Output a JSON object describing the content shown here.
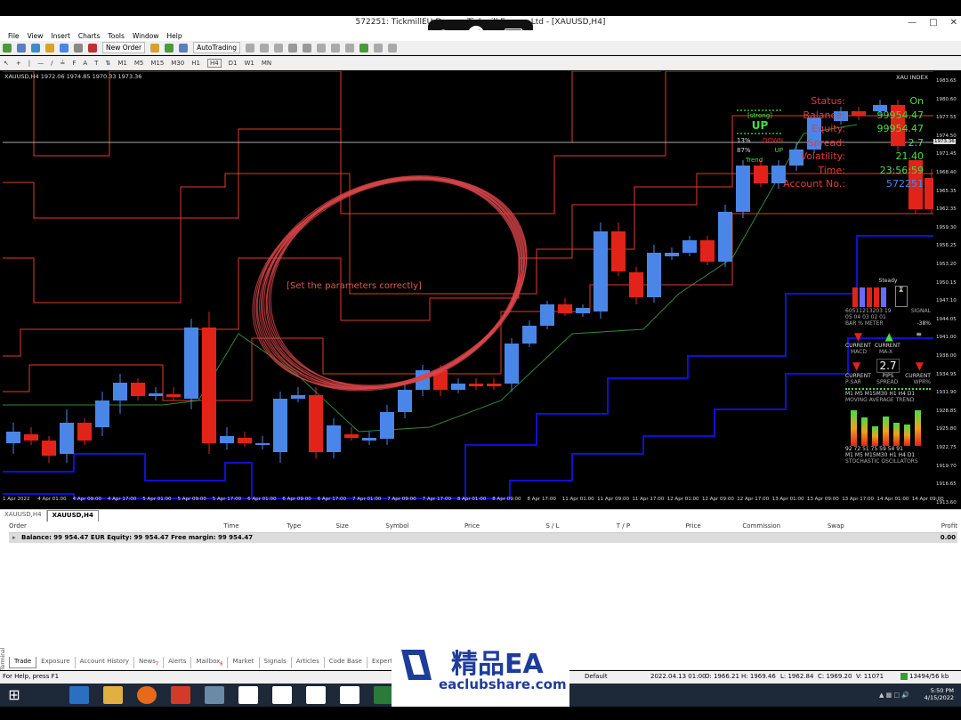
{
  "window": {
    "title": "572251: TickmillEU-Demo - Tickmill Europe Ltd - [XAUUSD,H4]",
    "controls": [
      "minimize-icon",
      "maximize-icon",
      "close-icon"
    ]
  },
  "remote_toolbar": {
    "icons": [
      "zoom-in-icon",
      "resize-icon",
      "keyboard-icon"
    ]
  },
  "menu": [
    "File",
    "View",
    "Insert",
    "Charts",
    "Tools",
    "Window",
    "Help"
  ],
  "toolbar": {
    "new_order": "New Order",
    "autotrading": "AutoTrading",
    "timeframes": [
      "M1",
      "M5",
      "M15",
      "M30",
      "H1",
      "H4",
      "D1",
      "W1",
      "MN"
    ],
    "active_timeframe": "H4"
  },
  "chart": {
    "info": "XAUUSD,H4  1972.06 1974.85 1970.33 1973.36",
    "index_label": "XAU INDEX",
    "center_text": "[Set the parameters correctly]",
    "current_price": "1973.36",
    "price_labels": [
      "1983.65",
      "1980.60",
      "1977.55",
      "1974.50",
      "1971.45",
      "1968.40",
      "1965.35",
      "1962.35",
      "1959.30",
      "1956.25",
      "1953.20",
      "1950.15",
      "1947.10",
      "1944.05",
      "1941.00",
      "1938.00",
      "1934.95",
      "1931.90",
      "1928.85",
      "1925.80",
      "1922.75",
      "1919.70",
      "1916.65",
      "1913.60"
    ],
    "time_labels": [
      "1 Apr 2022",
      "4 Apr 01:00",
      "4 Apr 09:00",
      "4 Apr 17:00",
      "5 Apr 01:00",
      "5 Apr 09:00",
      "5 Apr 17:00",
      "6 Apr 01:00",
      "6 Apr 09:00",
      "6 Apr 17:00",
      "7 Apr 01:00",
      "7 Apr 09:00",
      "7 Apr 17:00",
      "8 Apr 01:00",
      "8 Apr 09:00",
      "8 Apr 17:00",
      "11 Apr 01:00",
      "11 Apr 09:00",
      "11 Apr 17:00",
      "12 Apr 01:00",
      "12 Apr 09:00",
      "12 Apr 17:00",
      "13 Apr 01:00",
      "13 Apr 09:00",
      "13 Apr 17:00",
      "14 Apr 01:00",
      "14 Apr 09:00"
    ],
    "colors": {
      "bull": "#4a86e8",
      "bear": "#e2231a",
      "red_line": "#e53a2a",
      "green_line": "#2e8b3a",
      "blue_line": "#1010d0"
    }
  },
  "status_panel": [
    {
      "label": "Status:",
      "value": "On"
    },
    {
      "label": "Balance:",
      "value": "99954.47"
    },
    {
      "label": "Equity:",
      "value": "99954.47"
    },
    {
      "label": "Spread:",
      "value": "2.7"
    },
    {
      "label": "Volatility:",
      "value": "21.40"
    },
    {
      "label": "Time:",
      "value": "23:56:59"
    },
    {
      "label": "Account No.:",
      "value": "572251"
    }
  ],
  "strength": {
    "strong": "[strong]",
    "up": "UP",
    "down_pct": "13%",
    "down": "DOWN",
    "up_pct": "87%",
    "up_small": "UP",
    "trend": "Trend"
  },
  "meters": {
    "steady": "Steady",
    "bar_labels": "60511213203  19",
    "bar_tfs": "05 04 03 02 01",
    "signal": "SIGNAL",
    "bar_meter": "BAR % METER",
    "pct": "-38%",
    "current1": "CURRENT",
    "current2": "CURRENT",
    "macd": "MACD",
    "mafix": "MA-X",
    "spread_val": "2.7",
    "current3": "CURRENT",
    "pips": "PIPS",
    "current4": "CURRENT",
    "psar": "P-SAR",
    "spread": "SPREAD",
    "wpr": "WPR%",
    "ma_tfs": "M1 M5 M15M30 H1 H4 D1",
    "ma_trend": "MOVING AVERAGE TREND",
    "stoch_vals": "92 72 51 75 59 54 91",
    "stoch_tfs": "M1 M5 M15M30 H1 H4 D1",
    "stoch_label": "STOCHASTIC OSCILLATORS"
  },
  "chart_tabs": [
    "XAUUSD,H4",
    "XAUUSD,H4"
  ],
  "terminal": {
    "columns": [
      "Order",
      "Time",
      "Type",
      "Size",
      "Symbol",
      "Price",
      "S / L",
      "T / P",
      "Price",
      "Commission",
      "Swap",
      "Profit"
    ],
    "summary": "Balance: 99 954.47 EUR  Equity: 99 954.47  Free margin: 99 954.47",
    "profit": "0.00",
    "side_label": "Terminal",
    "tabs": [
      "Trade",
      "Exposure",
      "Account History",
      "News",
      "Alerts",
      "Mailbox",
      "Market",
      "Signals",
      "Articles",
      "Code Base",
      "Experts"
    ],
    "news_badge": "7",
    "mailbox_badge": "6"
  },
  "statusbar": {
    "help": "For Help, press F1",
    "profile": "Default",
    "datetime": "2022.04.13 01:00",
    "open": "O: 1966.21",
    "high": "H: 1969.46",
    "low": "L: 1962.84",
    "close": "C: 1969.20",
    "volume": "V: 11071",
    "traffic": "13494/56 kb"
  },
  "taskbar": {
    "time": "5:50 PM",
    "date": "4/15/2022"
  },
  "watermark": {
    "title": "精品EA",
    "url": "eaclubshare.com"
  }
}
